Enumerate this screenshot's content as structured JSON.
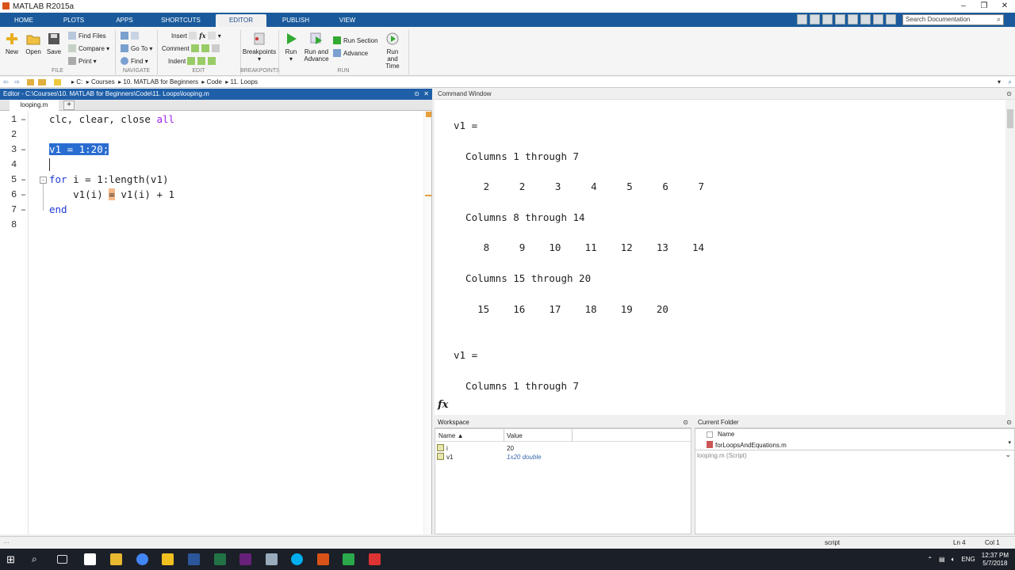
{
  "window": {
    "title": "MATLAB R2015a",
    "controls": [
      "–",
      "❐",
      "✕"
    ]
  },
  "tabs": [
    "HOME",
    "PLOTS",
    "APPS",
    "SHORTCUTS",
    "EDITOR",
    "PUBLISH",
    "VIEW"
  ],
  "active_tab": "EDITOR",
  "search": {
    "placeholder": "Search Documentation"
  },
  "ribbon": {
    "file": {
      "new": "New",
      "open": "Open",
      "save": "Save",
      "find_files": "Find Files",
      "compare": "Compare",
      "print": "Print",
      "group": "FILE"
    },
    "navigate": {
      "go_to": "Go To",
      "find": "Find",
      "group": "NAVIGATE"
    },
    "edit": {
      "insert": "Insert",
      "comment": "Comment",
      "indent": "Indent",
      "group": "EDIT"
    },
    "breakpoints": {
      "label": "Breakpoints",
      "group": "BREAKPOINTS"
    },
    "run": {
      "run": "Run",
      "run_and_advance_1": "Run and",
      "run_and_advance_2": "Advance",
      "run_section": "Run Section",
      "advance": "Advance",
      "run_and_time_1": "Run and",
      "run_and_time_2": "Time",
      "group": "RUN"
    }
  },
  "address": {
    "crumbs": [
      "C:",
      "Courses",
      "10. MATLAB for Beginners",
      "Code",
      "11. Loops"
    ]
  },
  "editor": {
    "title": "Editor - C:\\Courses\\10. MATLAB for Beginners\\Code\\11. Loops\\looping.m",
    "file_tab": "looping.m",
    "line_numbers": [
      "1",
      "2",
      "3",
      "4",
      "5",
      "6",
      "7",
      "8"
    ],
    "line1_a": "clc, clear, close ",
    "line1_b": "all",
    "line3_sel": "v1 = 1:20;",
    "line5_kw": "for",
    "line5_rest": " i = 1:length(v1)",
    "line6_a": "    v1(i) ",
    "line6_eq": "=",
    "line6_b": " v1(i) + 1",
    "line7": "end"
  },
  "command_window": {
    "title": "Command Window",
    "lines": [
      "v1 =",
      "  Columns 1 through 7",
      "     2     2     3     4     5     6     7",
      "  Columns 8 through 14",
      "     8     9    10    11    12    13    14",
      "  Columns 15 through 20",
      "    15    16    17    18    19    20",
      "v1 =",
      "  Columns 1 through 7"
    ],
    "prompt": "fx"
  },
  "workspace": {
    "title": "Workspace",
    "col_name": "Name ▲",
    "col_value": "Value",
    "rows": [
      {
        "name": "i",
        "value": "20"
      },
      {
        "name": "v1",
        "value": "1x20 double"
      }
    ]
  },
  "current_folder": {
    "title": "Current Folder",
    "col_name": "Name",
    "files": [
      "forLoopsAndEquations.m"
    ],
    "details": "looping.m  (Script)"
  },
  "status": {
    "mode": "script",
    "ln": "Ln  4",
    "col": "Col  1"
  },
  "tray": {
    "lang": "ENG",
    "time": "12:37 PM",
    "date": "5/7/2018"
  }
}
